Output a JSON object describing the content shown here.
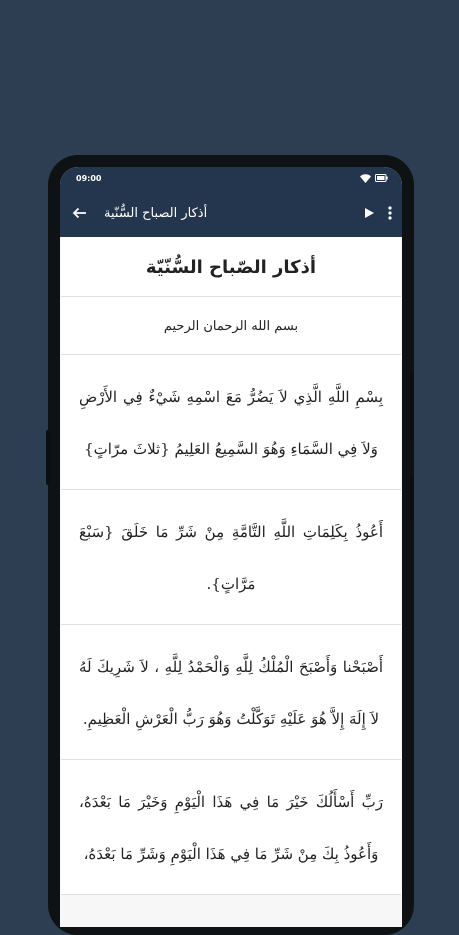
{
  "status_bar": {
    "time": "09:00"
  },
  "app_bar": {
    "title": "أذكار الصباح السُّنّية"
  },
  "content": {
    "heading": "أذكار الصّباح السُّنّيّة",
    "basmala": "بسم الله الرحمان الرحيم",
    "adhkar": [
      "بِسْمِ اللَّهِ الَّذِي لاَ يَضُرُّ مَعَ اسْمِهِ شَيْءٌ فِي الأَرْضِ وَلاَ فِي السَّمَاءِ وَهُوَ السَّمِيعُ العَلِيمُ {ثلاثَ مرّاتٍ}",
      "أَعُوذُ بِكَلِمَاتِ اللَّهِ التَّامَّةِ مِنْ شَرِّ مَا خَلَقَ {سَبْعَ مَرَّاتٍ}.",
      "أَصْبَحْنا وَأَصْبَحَ الْمُلْكُ لِلَّهِ وَالْحَمْدُ لِلَّهِ ، لاَ شَرِيكَ لَهُ لاَ إِلَهَ إِلاَّ هُوَ عَلَيْهِ تَوَكَّلْتُ وَهُوَ رَبُّ الْعَرْشِ الْعَظِيمِ.",
      "رَبِّ أَسْأَلُكَ خَيْرَ مَا فِي هَذَا الْيَوْمِ وَخَيْرَ مَا بَعْدَهُ، وَأَعُوذُ بِكَ مِنْ شَرِّ مَا فِي هَذَا الْيَوْمِ وَشَرِّ مَا بَعْدَهُ،"
    ]
  }
}
